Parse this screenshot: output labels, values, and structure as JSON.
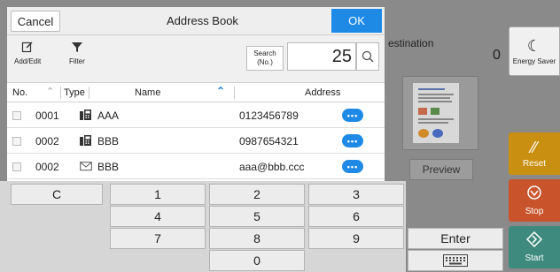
{
  "background": {
    "destination_label": "estination",
    "destination_count": "0",
    "preview_label": "Preview"
  },
  "side_buttons": {
    "energy_saver": "Energy Saver",
    "reset": "Reset",
    "stop": "Stop",
    "start": "Start"
  },
  "dialog": {
    "title": "Address Book",
    "cancel_label": "Cancel",
    "ok_label": "OK",
    "toolbar": {
      "add_edit_label": "Add/Edit",
      "filter_label": "Filter",
      "search_button_label": "Search (No.)",
      "search_value": "25"
    },
    "columns": {
      "no": "No.",
      "type": "Type",
      "name": "Name",
      "address": "Address"
    },
    "rows": [
      {
        "no": "0001",
        "type": "fax-icon",
        "name": "AAA",
        "address": "0123456789",
        "more": "•••"
      },
      {
        "no": "0002",
        "type": "fax-icon",
        "name": "BBB",
        "address": "0987654321",
        "more": "•••"
      },
      {
        "no": "0002",
        "type": "mail-icon",
        "name": "BBB",
        "address": "aaa@bbb.ccc",
        "more": "•••"
      }
    ]
  },
  "keypad": {
    "clear": "C",
    "k1": "1",
    "k2": "2",
    "k3": "3",
    "k4": "4",
    "k5": "5",
    "k6": "6",
    "k7": "7",
    "k8": "8",
    "k9": "9",
    "k0": "0",
    "enter": "Enter"
  },
  "colors": {
    "accent": "#1e8ae6",
    "reset": "#c98f10",
    "stop": "#c9542c",
    "start": "#3e8a7e"
  }
}
